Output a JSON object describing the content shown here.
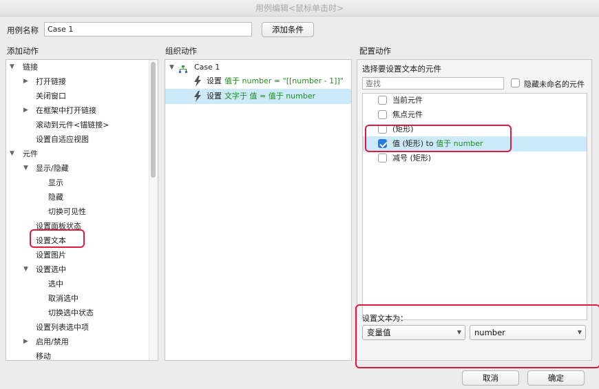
{
  "window": {
    "title": "用例编辑<鼠标单击时>"
  },
  "header": {
    "case_name_label": "用例名称",
    "case_name_value": "Case 1",
    "add_condition_label": "添加条件"
  },
  "sections": {
    "add_action": "添加动作",
    "organize_action": "组织动作",
    "configure_action": "配置动作"
  },
  "add_action_tree": [
    {
      "label": "链接",
      "arrow": "▼"
    },
    {
      "label": "打开链接",
      "arrow": "▶"
    },
    {
      "label": "关闭窗口",
      "arrow": ""
    },
    {
      "label": "在框架中打开链接",
      "arrow": "▶"
    },
    {
      "label": "滚动到元件<锚链接>",
      "arrow": ""
    },
    {
      "label": "设置自适应视图",
      "arrow": ""
    },
    {
      "label": "元件",
      "arrow": "▼"
    },
    {
      "label": "显示/隐藏",
      "arrow": "▼"
    },
    {
      "label": "显示",
      "arrow": ""
    },
    {
      "label": "隐藏",
      "arrow": ""
    },
    {
      "label": "切换可见性",
      "arrow": ""
    },
    {
      "label": "设置面板状态",
      "arrow": ""
    },
    {
      "label": "设置文本",
      "arrow": ""
    },
    {
      "label": "设置图片",
      "arrow": ""
    },
    {
      "label": "设置选中",
      "arrow": "▼"
    },
    {
      "label": "选中",
      "arrow": ""
    },
    {
      "label": "取消选中",
      "arrow": ""
    },
    {
      "label": "切换选中状态",
      "arrow": ""
    },
    {
      "label": "设置列表选中项",
      "arrow": ""
    },
    {
      "label": "启用/禁用",
      "arrow": "▶"
    },
    {
      "label": "移动",
      "arrow": ""
    }
  ],
  "organize_tree": {
    "case_label": "Case 1",
    "case_arrow": "▼",
    "actions": [
      {
        "prefix": "设置 ",
        "detail": "值于 number = \"[[number - 1]]\""
      },
      {
        "prefix": "设置 ",
        "detail": "文字于 值 = 值于 number"
      }
    ]
  },
  "configure": {
    "select_widget_label": "选择要设置文本的元件",
    "search_placeholder": "查找",
    "hide_unnamed_label": "隐藏未命名的元件",
    "widgets": [
      {
        "label": "当前元件",
        "checked": false
      },
      {
        "label": "焦点元件",
        "checked": false
      },
      {
        "label": "(矩形)",
        "checked": false
      },
      {
        "prefix": "值 (矩形) to ",
        "suffix": "值于 number",
        "checked": true
      },
      {
        "label": "减号 (矩形)",
        "checked": false
      }
    ],
    "set_text_label": "设置文本为：",
    "type_select_value": "变量值",
    "variable_select_value": "number"
  },
  "footer": {
    "cancel_label": "取消",
    "ok_label": "确定"
  },
  "colors": {
    "highlight": "#cbe9f8",
    "annotation_red": "#e2183c",
    "detail_green": "#1f8d1f",
    "check_blue": "#2c79e6"
  }
}
